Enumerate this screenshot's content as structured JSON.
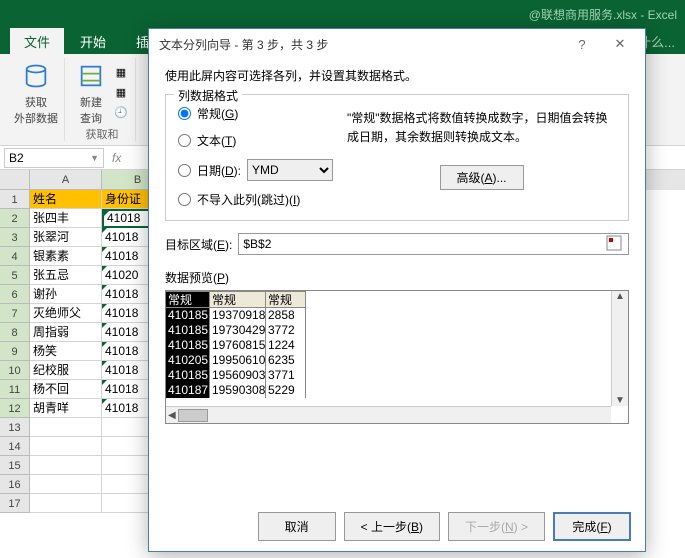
{
  "app": {
    "title_suffix": "@联想商用服务.xlsx - Excel",
    "tell_me": "告诉我您想要做什么..."
  },
  "tabs": {
    "file": "文件",
    "home": "开始",
    "insert": "插"
  },
  "ribbon": {
    "get_data": "获取\n外部数据",
    "new_query": "新建\n查询",
    "group_label": "获取和"
  },
  "namebox": "B2",
  "sheet": {
    "col_a_header": "姓名",
    "col_b_header": "身份证",
    "rows": [
      {
        "n": "1",
        "a": "姓名",
        "b": "身份证"
      },
      {
        "n": "2",
        "a": "张四丰",
        "b": "41018"
      },
      {
        "n": "3",
        "a": "张翠河",
        "b": "41018"
      },
      {
        "n": "4",
        "a": "银素素",
        "b": "41018"
      },
      {
        "n": "5",
        "a": "张五忌",
        "b": "41020"
      },
      {
        "n": "6",
        "a": "谢孙",
        "b": "41018"
      },
      {
        "n": "7",
        "a": "灭绝师父",
        "b": "41018"
      },
      {
        "n": "8",
        "a": "周指弱",
        "b": "41018"
      },
      {
        "n": "9",
        "a": "杨笑",
        "b": "41018"
      },
      {
        "n": "10",
        "a": "纪校服",
        "b": "41018"
      },
      {
        "n": "11",
        "a": "杨不回",
        "b": "41018"
      },
      {
        "n": "12",
        "a": "胡青咩",
        "b": "41018"
      },
      {
        "n": "13",
        "a": "",
        "b": ""
      },
      {
        "n": "14",
        "a": "",
        "b": ""
      },
      {
        "n": "15",
        "a": "",
        "b": ""
      },
      {
        "n": "16",
        "a": "",
        "b": ""
      },
      {
        "n": "17",
        "a": "",
        "b": ""
      }
    ]
  },
  "dialog": {
    "title": "文本分列向导 - 第 3 步，共 3 步",
    "instruction": "使用此屏内容可选择各列，并设置其数据格式。",
    "fieldset_legend": "列数据格式",
    "radio_general": "常规(G)",
    "radio_text": "文本(T)",
    "radio_date": "日期(D):",
    "date_format": "YMD",
    "radio_skip": "不导入此列(跳过)(I)",
    "desc": "\"常规\"数据格式将数值转换成数字，日期值会转换成日期，其余数据则转换成文本。",
    "advanced": "高级(A)...",
    "dest_label": "目标区域(E):",
    "dest_value": "$B$2",
    "preview_label": "数据预览(P)",
    "preview_headers": [
      "常规",
      "常规",
      "常规"
    ],
    "preview_rows": [
      [
        "410185",
        "19370918",
        "2858"
      ],
      [
        "410185",
        "19730429",
        "3772"
      ],
      [
        "410185",
        "19760815",
        "1224"
      ],
      [
        "410205",
        "19950610",
        "6235"
      ],
      [
        "410185",
        "19560903",
        "3771"
      ],
      [
        "410187",
        "19590308",
        "5229"
      ]
    ],
    "btn_cancel": "取消",
    "btn_back": "< 上一步(B)",
    "btn_next": "下一步(N) >",
    "btn_finish": "完成(F)"
  }
}
